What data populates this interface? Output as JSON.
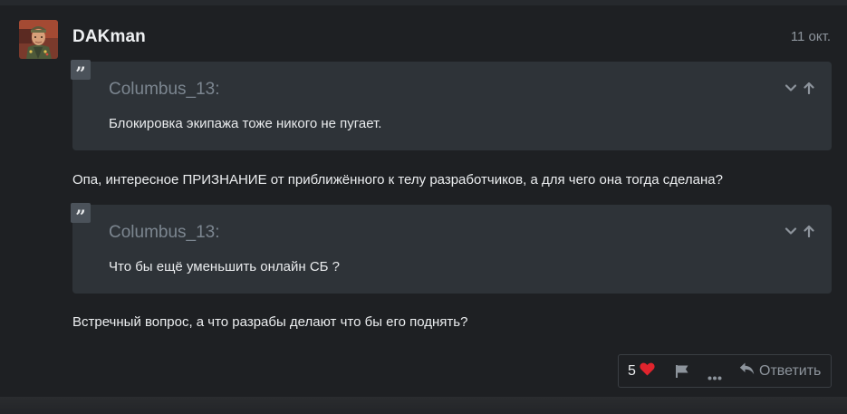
{
  "post": {
    "author": "DAKman",
    "date": "11 окт.",
    "quotes": [
      {
        "author": "Columbus_13:",
        "text": "Блокировка экипажа тоже никого не пугает."
      },
      {
        "author": "Columbus_13:",
        "text": "Что бы ещё уменьшить онлайн СБ ?"
      }
    ],
    "paragraphs": [
      "Опа, интересное ПРИЗНАНИЕ от приближённого к телу разработчиков, а для чего она тогда сделана?",
      "Встречный вопрос, а что разрабы делают что бы его поднять?"
    ],
    "actions": {
      "like_count": "5",
      "reply_label": "Ответить"
    }
  },
  "icons": {
    "avatar": "soldier-avatar",
    "quote": "quote-icon",
    "expand": "chevron-down-icon",
    "goto": "arrow-up-icon",
    "like": "heart-icon",
    "report": "flag-icon",
    "more": "ellipsis-icon",
    "reply": "reply-icon"
  },
  "colors": {
    "background": "#1e2023",
    "quote_background": "#2e3338",
    "heart": "#e0242d",
    "muted": "#8d949c"
  }
}
